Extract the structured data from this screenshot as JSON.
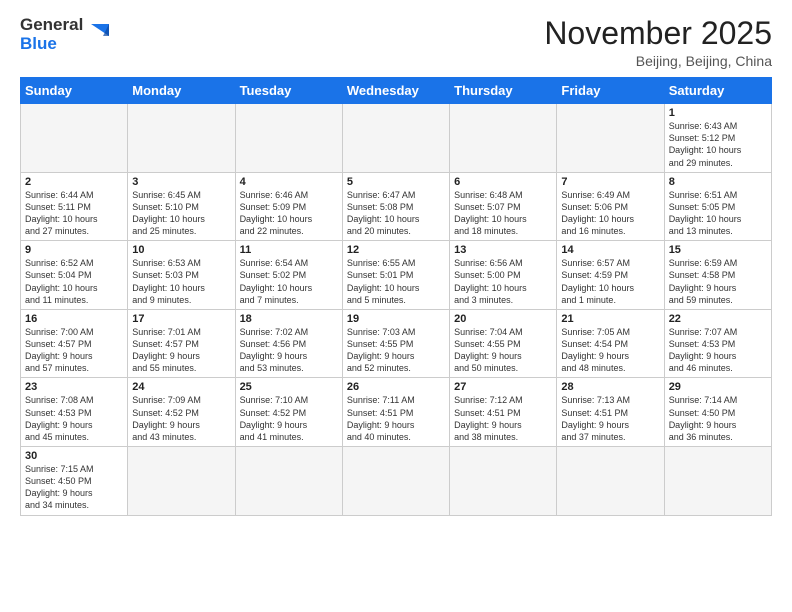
{
  "header": {
    "logo_general": "General",
    "logo_blue": "Blue",
    "title": "November 2025",
    "location": "Beijing, Beijing, China"
  },
  "weekdays": [
    "Sunday",
    "Monday",
    "Tuesday",
    "Wednesday",
    "Thursday",
    "Friday",
    "Saturday"
  ],
  "weeks": [
    [
      {
        "day": "",
        "info": ""
      },
      {
        "day": "",
        "info": ""
      },
      {
        "day": "",
        "info": ""
      },
      {
        "day": "",
        "info": ""
      },
      {
        "day": "",
        "info": ""
      },
      {
        "day": "",
        "info": ""
      },
      {
        "day": "1",
        "info": "Sunrise: 6:43 AM\nSunset: 5:12 PM\nDaylight: 10 hours\nand 29 minutes."
      }
    ],
    [
      {
        "day": "2",
        "info": "Sunrise: 6:44 AM\nSunset: 5:11 PM\nDaylight: 10 hours\nand 27 minutes."
      },
      {
        "day": "3",
        "info": "Sunrise: 6:45 AM\nSunset: 5:10 PM\nDaylight: 10 hours\nand 25 minutes."
      },
      {
        "day": "4",
        "info": "Sunrise: 6:46 AM\nSunset: 5:09 PM\nDaylight: 10 hours\nand 22 minutes."
      },
      {
        "day": "5",
        "info": "Sunrise: 6:47 AM\nSunset: 5:08 PM\nDaylight: 10 hours\nand 20 minutes."
      },
      {
        "day": "6",
        "info": "Sunrise: 6:48 AM\nSunset: 5:07 PM\nDaylight: 10 hours\nand 18 minutes."
      },
      {
        "day": "7",
        "info": "Sunrise: 6:49 AM\nSunset: 5:06 PM\nDaylight: 10 hours\nand 16 minutes."
      },
      {
        "day": "8",
        "info": "Sunrise: 6:51 AM\nSunset: 5:05 PM\nDaylight: 10 hours\nand 13 minutes."
      }
    ],
    [
      {
        "day": "9",
        "info": "Sunrise: 6:52 AM\nSunset: 5:04 PM\nDaylight: 10 hours\nand 11 minutes."
      },
      {
        "day": "10",
        "info": "Sunrise: 6:53 AM\nSunset: 5:03 PM\nDaylight: 10 hours\nand 9 minutes."
      },
      {
        "day": "11",
        "info": "Sunrise: 6:54 AM\nSunset: 5:02 PM\nDaylight: 10 hours\nand 7 minutes."
      },
      {
        "day": "12",
        "info": "Sunrise: 6:55 AM\nSunset: 5:01 PM\nDaylight: 10 hours\nand 5 minutes."
      },
      {
        "day": "13",
        "info": "Sunrise: 6:56 AM\nSunset: 5:00 PM\nDaylight: 10 hours\nand 3 minutes."
      },
      {
        "day": "14",
        "info": "Sunrise: 6:57 AM\nSunset: 4:59 PM\nDaylight: 10 hours\nand 1 minute."
      },
      {
        "day": "15",
        "info": "Sunrise: 6:59 AM\nSunset: 4:58 PM\nDaylight: 9 hours\nand 59 minutes."
      }
    ],
    [
      {
        "day": "16",
        "info": "Sunrise: 7:00 AM\nSunset: 4:57 PM\nDaylight: 9 hours\nand 57 minutes."
      },
      {
        "day": "17",
        "info": "Sunrise: 7:01 AM\nSunset: 4:57 PM\nDaylight: 9 hours\nand 55 minutes."
      },
      {
        "day": "18",
        "info": "Sunrise: 7:02 AM\nSunset: 4:56 PM\nDaylight: 9 hours\nand 53 minutes."
      },
      {
        "day": "19",
        "info": "Sunrise: 7:03 AM\nSunset: 4:55 PM\nDaylight: 9 hours\nand 52 minutes."
      },
      {
        "day": "20",
        "info": "Sunrise: 7:04 AM\nSunset: 4:55 PM\nDaylight: 9 hours\nand 50 minutes."
      },
      {
        "day": "21",
        "info": "Sunrise: 7:05 AM\nSunset: 4:54 PM\nDaylight: 9 hours\nand 48 minutes."
      },
      {
        "day": "22",
        "info": "Sunrise: 7:07 AM\nSunset: 4:53 PM\nDaylight: 9 hours\nand 46 minutes."
      }
    ],
    [
      {
        "day": "23",
        "info": "Sunrise: 7:08 AM\nSunset: 4:53 PM\nDaylight: 9 hours\nand 45 minutes."
      },
      {
        "day": "24",
        "info": "Sunrise: 7:09 AM\nSunset: 4:52 PM\nDaylight: 9 hours\nand 43 minutes."
      },
      {
        "day": "25",
        "info": "Sunrise: 7:10 AM\nSunset: 4:52 PM\nDaylight: 9 hours\nand 41 minutes."
      },
      {
        "day": "26",
        "info": "Sunrise: 7:11 AM\nSunset: 4:51 PM\nDaylight: 9 hours\nand 40 minutes."
      },
      {
        "day": "27",
        "info": "Sunrise: 7:12 AM\nSunset: 4:51 PM\nDaylight: 9 hours\nand 38 minutes."
      },
      {
        "day": "28",
        "info": "Sunrise: 7:13 AM\nSunset: 4:51 PM\nDaylight: 9 hours\nand 37 minutes."
      },
      {
        "day": "29",
        "info": "Sunrise: 7:14 AM\nSunset: 4:50 PM\nDaylight: 9 hours\nand 36 minutes."
      }
    ],
    [
      {
        "day": "30",
        "info": "Sunrise: 7:15 AM\nSunset: 4:50 PM\nDaylight: 9 hours\nand 34 minutes."
      },
      {
        "day": "",
        "info": ""
      },
      {
        "day": "",
        "info": ""
      },
      {
        "day": "",
        "info": ""
      },
      {
        "day": "",
        "info": ""
      },
      {
        "day": "",
        "info": ""
      },
      {
        "day": "",
        "info": ""
      }
    ]
  ]
}
